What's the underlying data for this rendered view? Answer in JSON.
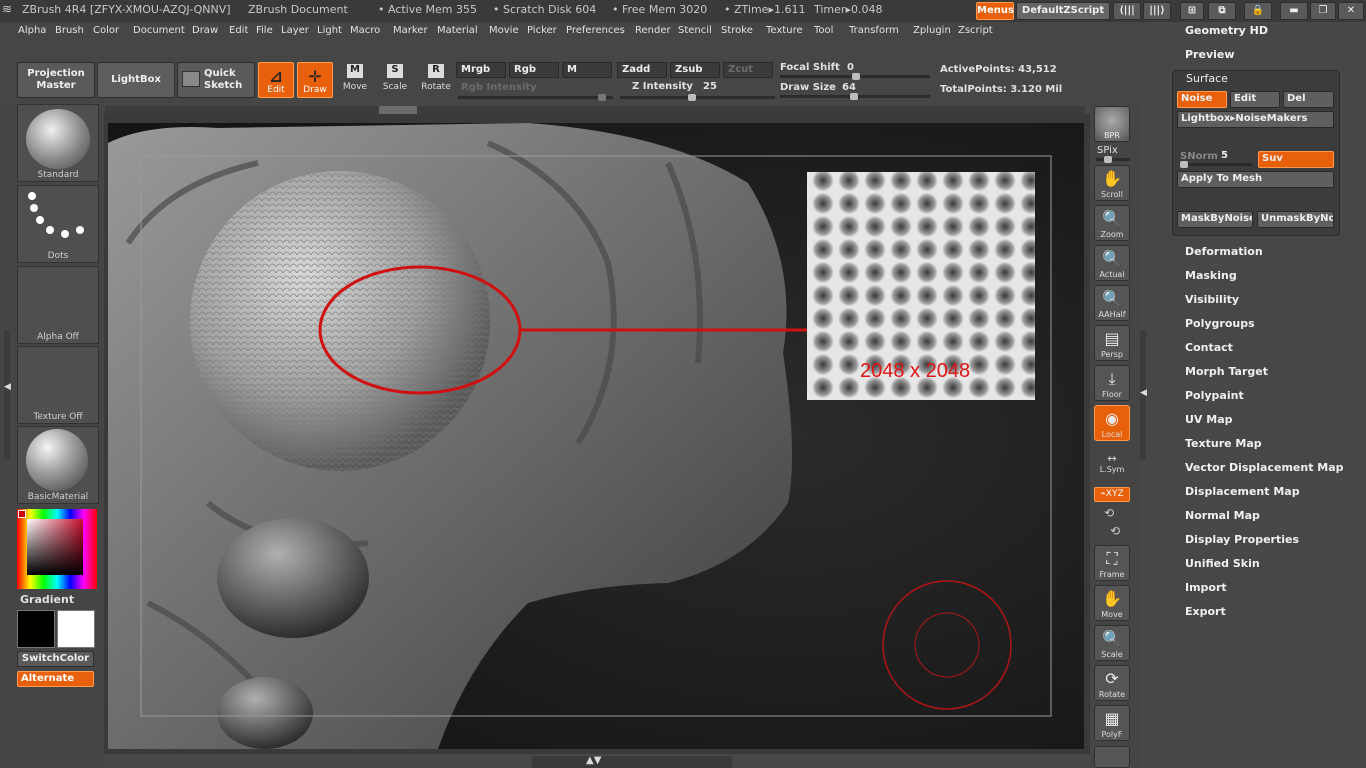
{
  "titlebar": {
    "app": "ZBrush 4R4 [ZFYX-XMOU-AZQJ-QNNV]",
    "doc": "ZBrush Document",
    "active_mem": "• Active Mem 355",
    "scratch": "• Scratch Disk 604",
    "free_mem": "• Free Mem 3020",
    "ztime": "• ZTime▸1.611",
    "timer": "Timer▸0.048",
    "menus_btn": "Menus",
    "script_btn": "DefaultZScript"
  },
  "menubar": [
    "Alpha",
    "Brush",
    "Color",
    "Document",
    "Draw",
    "Edit",
    "File",
    "Layer",
    "Light",
    "Macro",
    "Marker",
    "Material",
    "Movie",
    "Picker",
    "Preferences",
    "Render",
    "Stencil",
    "Stroke",
    "Texture",
    "Tool",
    "Transform",
    "Zplugin",
    "Zscript"
  ],
  "toolbar": {
    "projection_master": "Projection Master",
    "lightbox": "LightBox",
    "quick_sketch": "Quick Sketch",
    "edit": "Edit",
    "draw": "Draw",
    "move": "Move",
    "scale": "Scale",
    "rotate": "Rotate",
    "mrgb": "Mrgb",
    "rgb": "Rgb",
    "m": "M",
    "zadd": "Zadd",
    "zsub": "Zsub",
    "zcut": "Zcut",
    "rgb_intensity": "Rgb Intensity",
    "z_intensity_label": "Z Intensity",
    "z_intensity": "25",
    "focal_shift_label": "Focal Shift",
    "focal_shift": "0",
    "draw_size_label": "Draw Size",
    "draw_size": "64",
    "active_points": "ActivePoints: 43,512",
    "total_points": "TotalPoints: 3.120 Mil"
  },
  "left_shelf": {
    "brush": "Standard",
    "stroke": "Dots",
    "alpha": "Alpha  Off",
    "texture": "Texture  Off",
    "material": "BasicMaterial",
    "gradient": "Gradient",
    "switch_color": "SwitchColor",
    "alternate": "Alternate"
  },
  "right_shelf": {
    "bpr": "BPR",
    "spix": "SPix",
    "scroll": "Scroll",
    "zoom": "Zoom",
    "actual": "Actual",
    "aahalf": "AAHalf",
    "persp": "Persp",
    "floor": "Floor",
    "local": "Local",
    "lsym": "L.Sym",
    "xyz": "⌁XYZ",
    "frame": "Frame",
    "move": "Move",
    "scale": "Scale",
    "rotate": "Rotate",
    "polyf": "PolyF"
  },
  "canvas": {
    "annotation": "2048 x 2048"
  },
  "tool_panel": {
    "geometry_hd": "Geometry HD",
    "preview": "Preview",
    "surface": "Surface",
    "noise": "Noise",
    "edit": "Edit",
    "del": "Del",
    "lightbox_noisemakers": "Lightbox▸NoiseMakers",
    "snorm_label": "SNorm",
    "snorm": "5",
    "suv": "Suv",
    "apply_to_mesh": "Apply To Mesh",
    "mask_by_noise": "MaskByNoise",
    "unmask_by_noise": "UnmaskByNo",
    "sections": [
      "Deformation",
      "Masking",
      "Visibility",
      "Polygroups",
      "Contact",
      "Morph Target",
      "Polypaint",
      "UV Map",
      "Texture Map",
      "Vector Displacement Map",
      "Displacement Map",
      "Normal Map",
      "Display Properties",
      "Unified Skin",
      "Import",
      "Export"
    ]
  }
}
